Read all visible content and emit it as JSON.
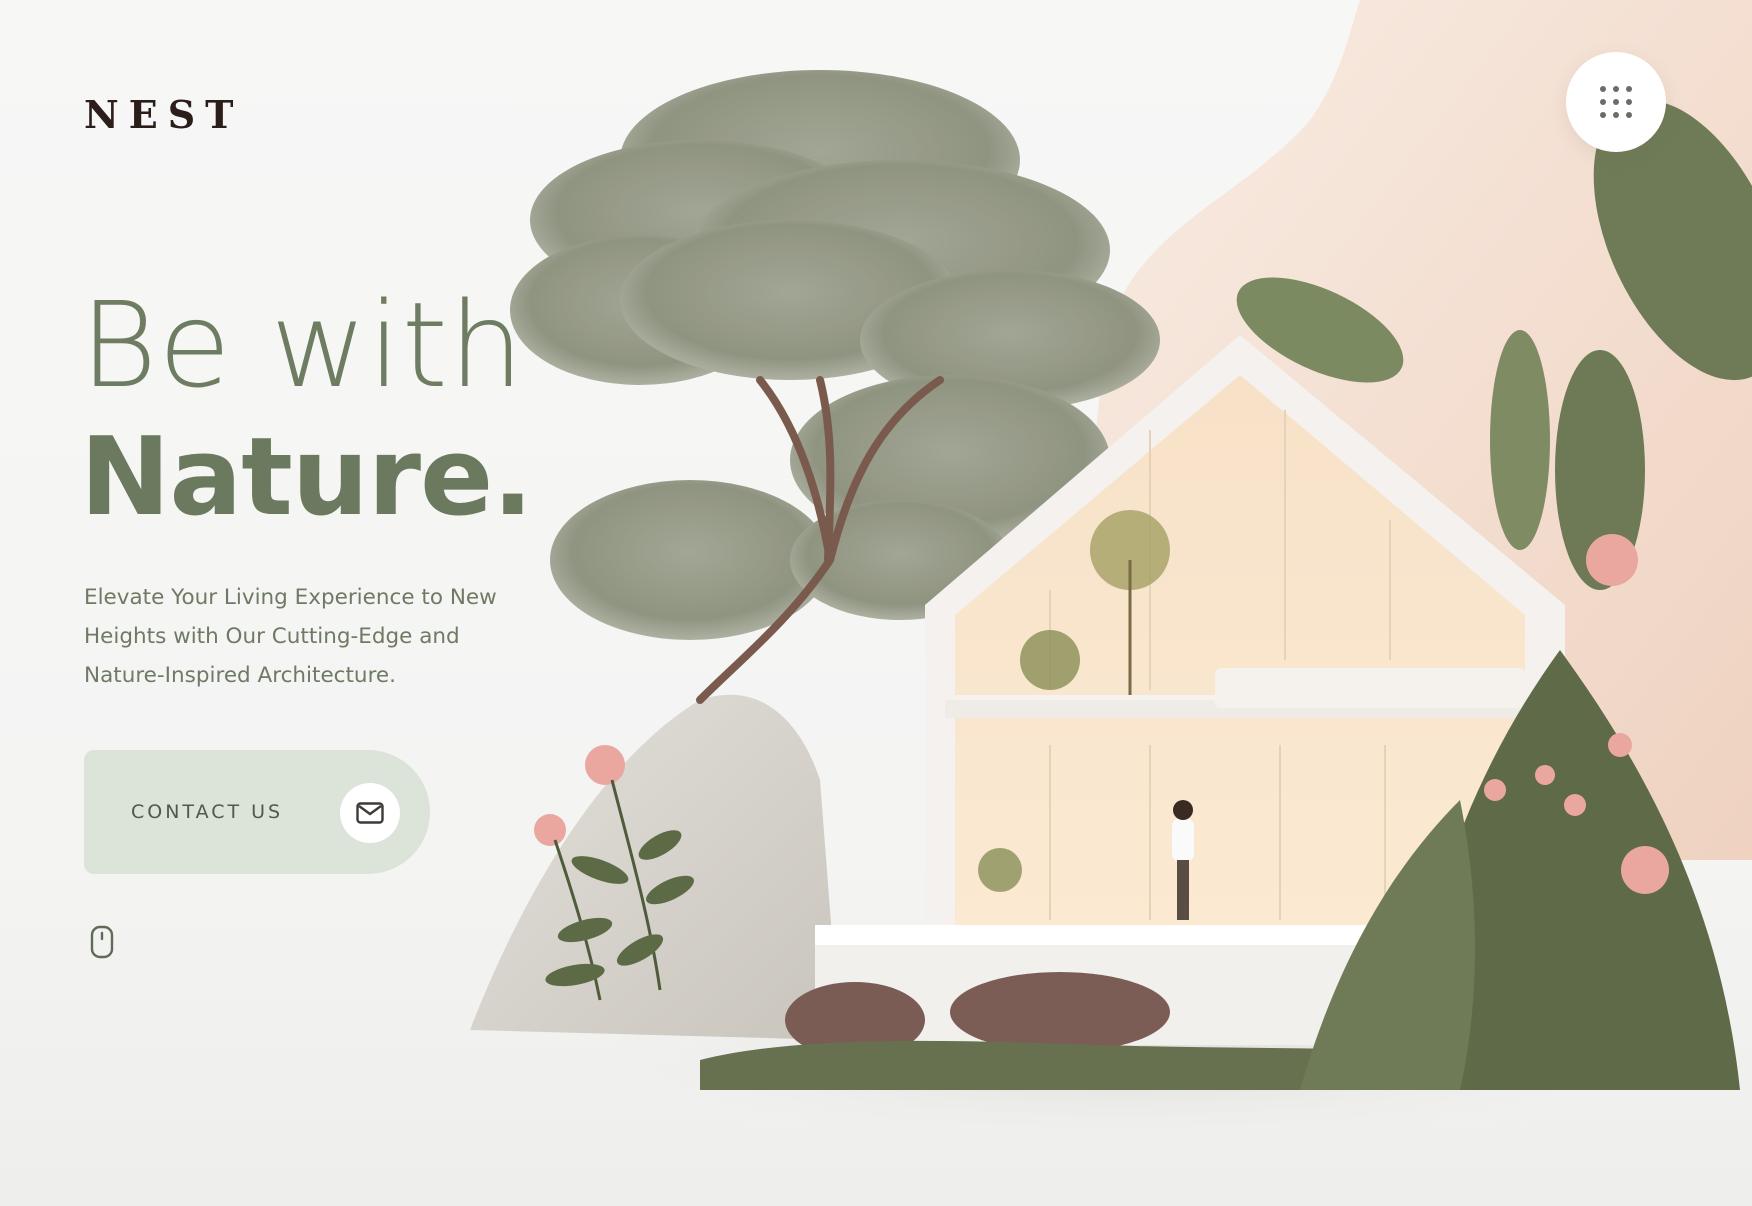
{
  "brand": {
    "logo_text": "NEST"
  },
  "hero": {
    "headline_line1": "Be with",
    "headline_line2": "Nature.",
    "subtitle_lines": [
      "Elevate Your Living Experience to New",
      "Heights with Our Cutting-Edge and",
      "Nature-Inspired Architecture."
    ]
  },
  "cta": {
    "contact_label": "CONTACT US"
  },
  "icons": {
    "menu": "grid-dots-icon",
    "contact": "mail-icon",
    "scroll": "mouse-scroll-icon"
  },
  "colors": {
    "accent": "#6b7a5e",
    "button_bg": "#dce3d9",
    "logo": "#2a1d1a",
    "peach_backdrop": "#f3dccb"
  }
}
